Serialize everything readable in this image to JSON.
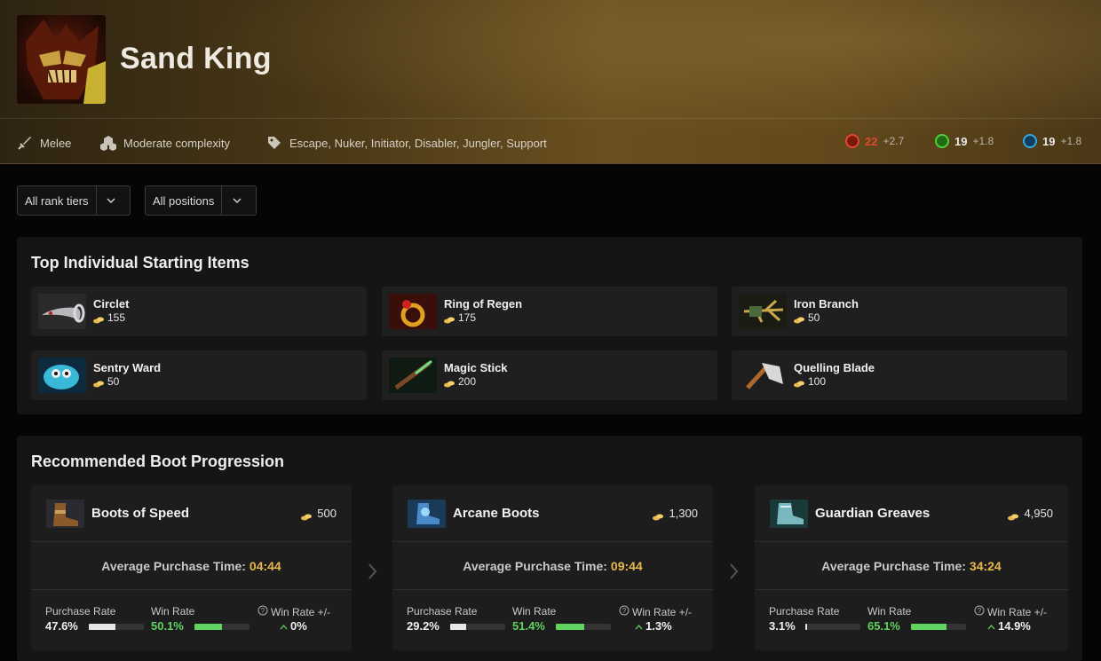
{
  "hero": {
    "name": "Sand King",
    "attack_type": "Melee",
    "complexity": "Moderate complexity",
    "roles": "Escape, Nuker, Initiator, Disabler, Jungler, Support",
    "attributes": {
      "strength": {
        "base": "22",
        "gain": "+2.7",
        "color": "#e0492f"
      },
      "agility": {
        "base": "19",
        "gain": "+1.8",
        "color": "#4fcf3a"
      },
      "intelligence": {
        "base": "19",
        "gain": "+1.8",
        "color": "#35a8e0"
      }
    }
  },
  "filters": {
    "rank": "All rank tiers",
    "position": "All positions"
  },
  "starting_items": {
    "title": "Top Individual Starting Items",
    "items": [
      {
        "name": "Circlet",
        "cost": "155"
      },
      {
        "name": "Ring of Regen",
        "cost": "175"
      },
      {
        "name": "Iron Branch",
        "cost": "50"
      },
      {
        "name": "Sentry Ward",
        "cost": "50"
      },
      {
        "name": "Magic Stick",
        "cost": "200"
      },
      {
        "name": "Quelling Blade",
        "cost": "100"
      }
    ]
  },
  "boots": {
    "title": "Recommended Boot Progression",
    "labels": {
      "avg_time": "Average Purchase Time:",
      "purchase_rate": "Purchase Rate",
      "win_rate": "Win Rate",
      "win_rate_delta": "Win Rate  +/-"
    },
    "items": [
      {
        "name": "Boots of Speed",
        "cost": "500",
        "time": "04:44",
        "purchase_rate": "47.6%",
        "purchase_fill": 0.476,
        "win_rate": "50.1%",
        "win_fill": 0.501,
        "delta": "0%"
      },
      {
        "name": "Arcane Boots",
        "cost": "1,300",
        "time": "09:44",
        "purchase_rate": "29.2%",
        "purchase_fill": 0.292,
        "win_rate": "51.4%",
        "win_fill": 0.514,
        "delta": "1.3%"
      },
      {
        "name": "Guardian Greaves",
        "cost": "4,950",
        "time": "34:24",
        "purchase_rate": "3.1%",
        "purchase_fill": 0.031,
        "win_rate": "65.1%",
        "win_fill": 0.651,
        "delta": "14.9%"
      }
    ]
  },
  "colors": {
    "gold": "#e9b84a",
    "green": "#5fd35f",
    "bar_white": "#e6e6e6"
  }
}
